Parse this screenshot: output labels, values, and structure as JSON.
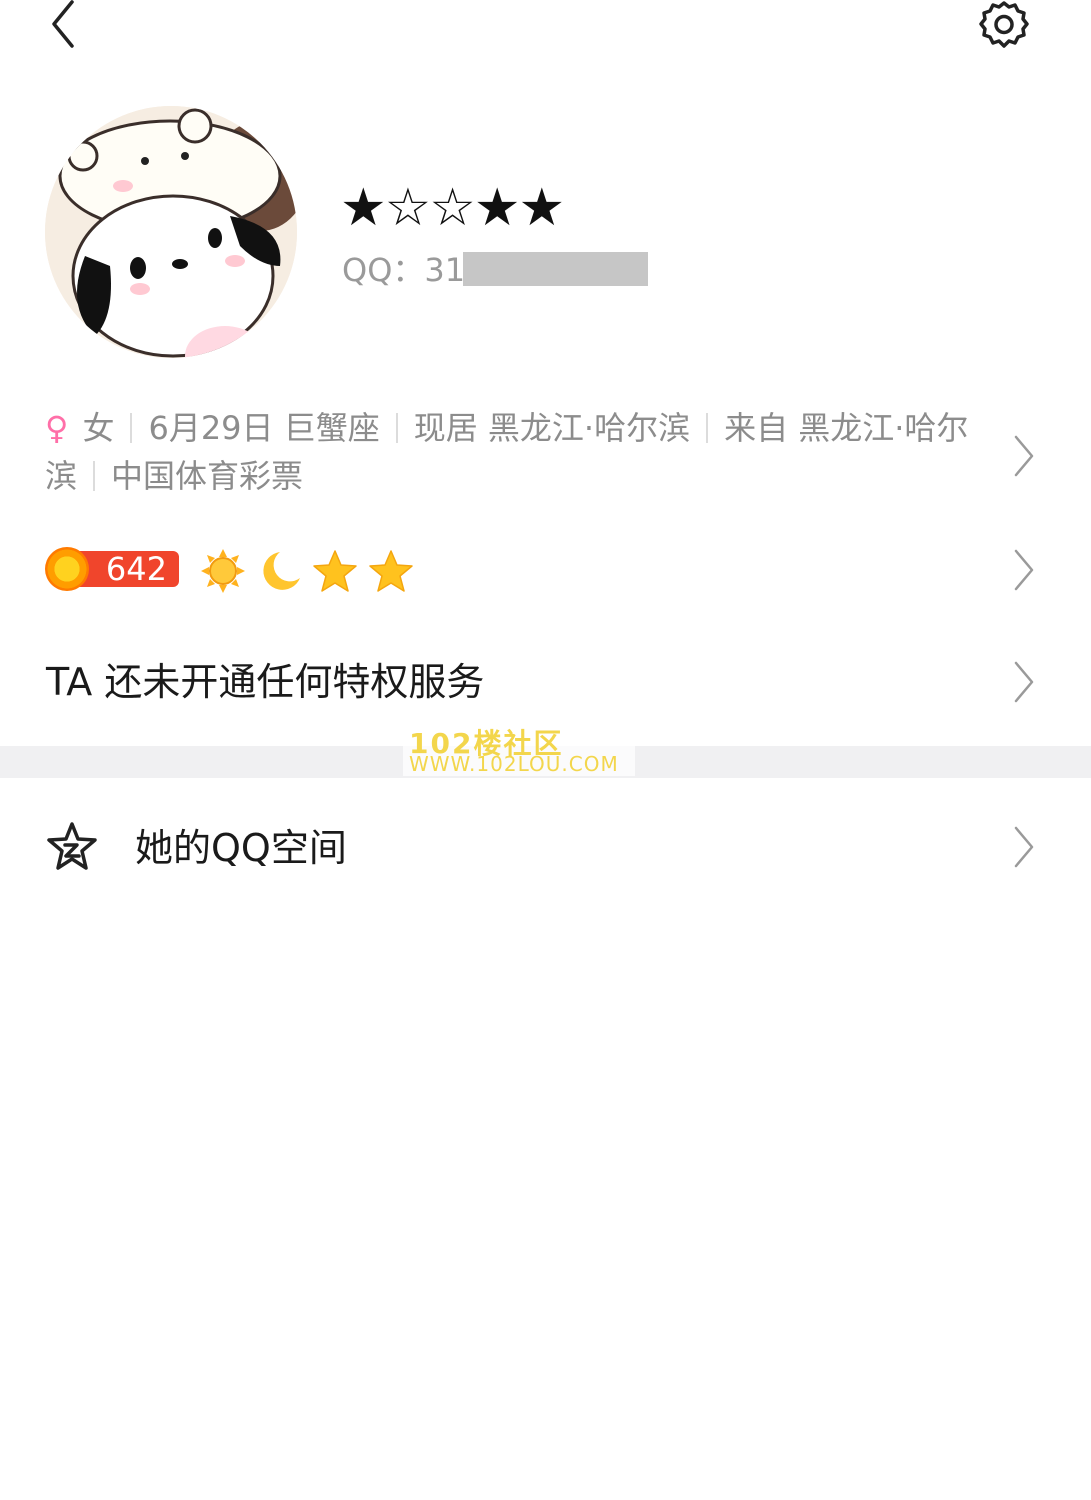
{
  "profile": {
    "nickname": "★☆☆★★",
    "qq_label": "QQ：",
    "qq_partial": "31"
  },
  "info": {
    "gender_symbol": "♀",
    "gender": "女",
    "birthday": "6月29日 巨蟹座",
    "residence": "现居 黑龙江·哈尔滨",
    "hometown": "来自 黑龙江·哈尔滨",
    "company": "中国体育彩票"
  },
  "level": {
    "value": "642",
    "icons": [
      "sun-icon",
      "moon-icon",
      "star-icon",
      "star-icon"
    ]
  },
  "privilege": {
    "text": "TA 还未开通任何特权服务"
  },
  "watermark": {
    "title": "102楼社区",
    "url": "WWW.102LOU.COM"
  },
  "qzone": {
    "label": "她的QQ空间"
  },
  "colors": {
    "female": "#ff6fa8",
    "level_red": "#f0452c",
    "band": "#f0f0f2"
  }
}
